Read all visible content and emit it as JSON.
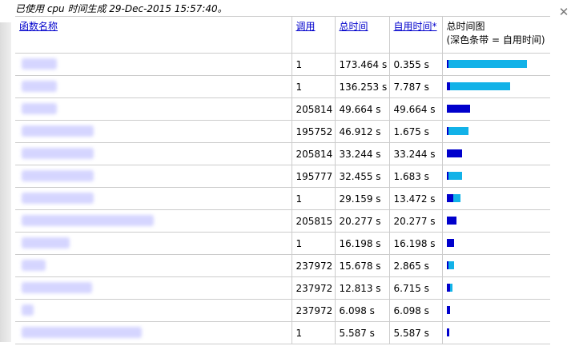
{
  "window": {
    "title": "已使用 cpu 时间生成 29-Dec-2015 15:57:40。",
    "close_glyph": "✕"
  },
  "table": {
    "headers": {
      "name": "函数名称",
      "calls": "调用",
      "total_time": "总时间",
      "self_time": "自用时间*",
      "chart_line1": "总时间图",
      "chart_line2": "(深色条带 = 自用时间)"
    },
    "rows": [
      {
        "calls": "1",
        "total": "173.464 s",
        "self": "0.355 s",
        "total_val": 173.464,
        "self_val": 0.355
      },
      {
        "calls": "1",
        "total": "136.253 s",
        "self": "7.787 s",
        "total_val": 136.253,
        "self_val": 7.787
      },
      {
        "calls": "205814",
        "total": "49.664 s",
        "self": "49.664 s",
        "total_val": 49.664,
        "self_val": 49.664
      },
      {
        "calls": "195752",
        "total": "46.912 s",
        "self": "1.675 s",
        "total_val": 46.912,
        "self_val": 1.675
      },
      {
        "calls": "205814",
        "total": "33.244 s",
        "self": "33.244 s",
        "total_val": 33.244,
        "self_val": 33.244
      },
      {
        "calls": "195777",
        "total": "32.455 s",
        "self": "1.683 s",
        "total_val": 32.455,
        "self_val": 1.683
      },
      {
        "calls": "1",
        "total": "29.159 s",
        "self": "13.472 s",
        "total_val": 29.159,
        "self_val": 13.472
      },
      {
        "calls": "205815",
        "total": "20.277 s",
        "self": "20.277 s",
        "total_val": 20.277,
        "self_val": 20.277
      },
      {
        "calls": "1",
        "total": "16.198 s",
        "self": "16.198 s",
        "total_val": 16.198,
        "self_val": 16.198
      },
      {
        "calls": "237972",
        "total": "15.678 s",
        "self": "2.865 s",
        "total_val": 15.678,
        "self_val": 2.865
      },
      {
        "calls": "237972",
        "total": "12.813 s",
        "self": "6.715 s",
        "total_val": 12.813,
        "self_val": 6.715
      },
      {
        "calls": "237972",
        "total": "6.098 s",
        "self": "6.098 s",
        "total_val": 6.098,
        "self_val": 6.098
      },
      {
        "calls": "1",
        "total": "5.587 s",
        "self": "5.587 s",
        "total_val": 5.587,
        "self_val": 5.587
      }
    ]
  },
  "colors": {
    "self_bar": "#0000cc",
    "total_bar": "#12b2e8",
    "link": "#0000cc"
  }
}
